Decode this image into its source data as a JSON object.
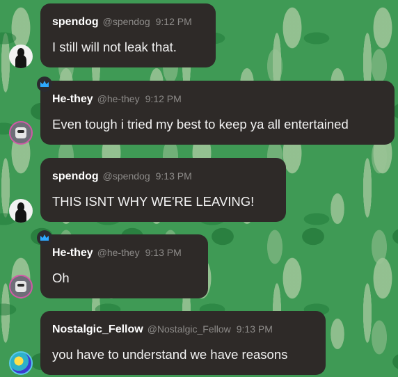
{
  "messages": [
    {
      "user": "spendog",
      "handle": "@spendog",
      "time": "9:12 PM",
      "text": "I still will not leak that.",
      "avatar": "silhouette-avatar"
    },
    {
      "user": "He-they",
      "handle": "@he-they",
      "time": "9:12 PM",
      "text": "Even tough i tried my best to keep ya all entertained",
      "avatar": "robot-avatar",
      "badge": "crown-badge-icon"
    },
    {
      "user": "spendog",
      "handle": "@spendog",
      "time": "9:13 PM",
      "text": "THIS ISNT WHY WE'RE LEAVING!",
      "avatar": "silhouette-avatar"
    },
    {
      "user": "He-they",
      "handle": "@he-they",
      "time": "9:13 PM",
      "text": "Oh",
      "avatar": "robot-avatar",
      "badge": "crown-badge-icon"
    },
    {
      "user": "Nostalgic_Fellow",
      "handle": "@Nostalgic_Fellow",
      "time": "9:13 PM",
      "text": "you have to understand we have reasons",
      "avatar": "colorful-avatar"
    }
  ],
  "colors": {
    "bubble": "#2e2a28",
    "name": "#ffffff",
    "meta": "#8d8b89",
    "badge_crown": "#2ea8ff",
    "background": "#3f9a55"
  }
}
